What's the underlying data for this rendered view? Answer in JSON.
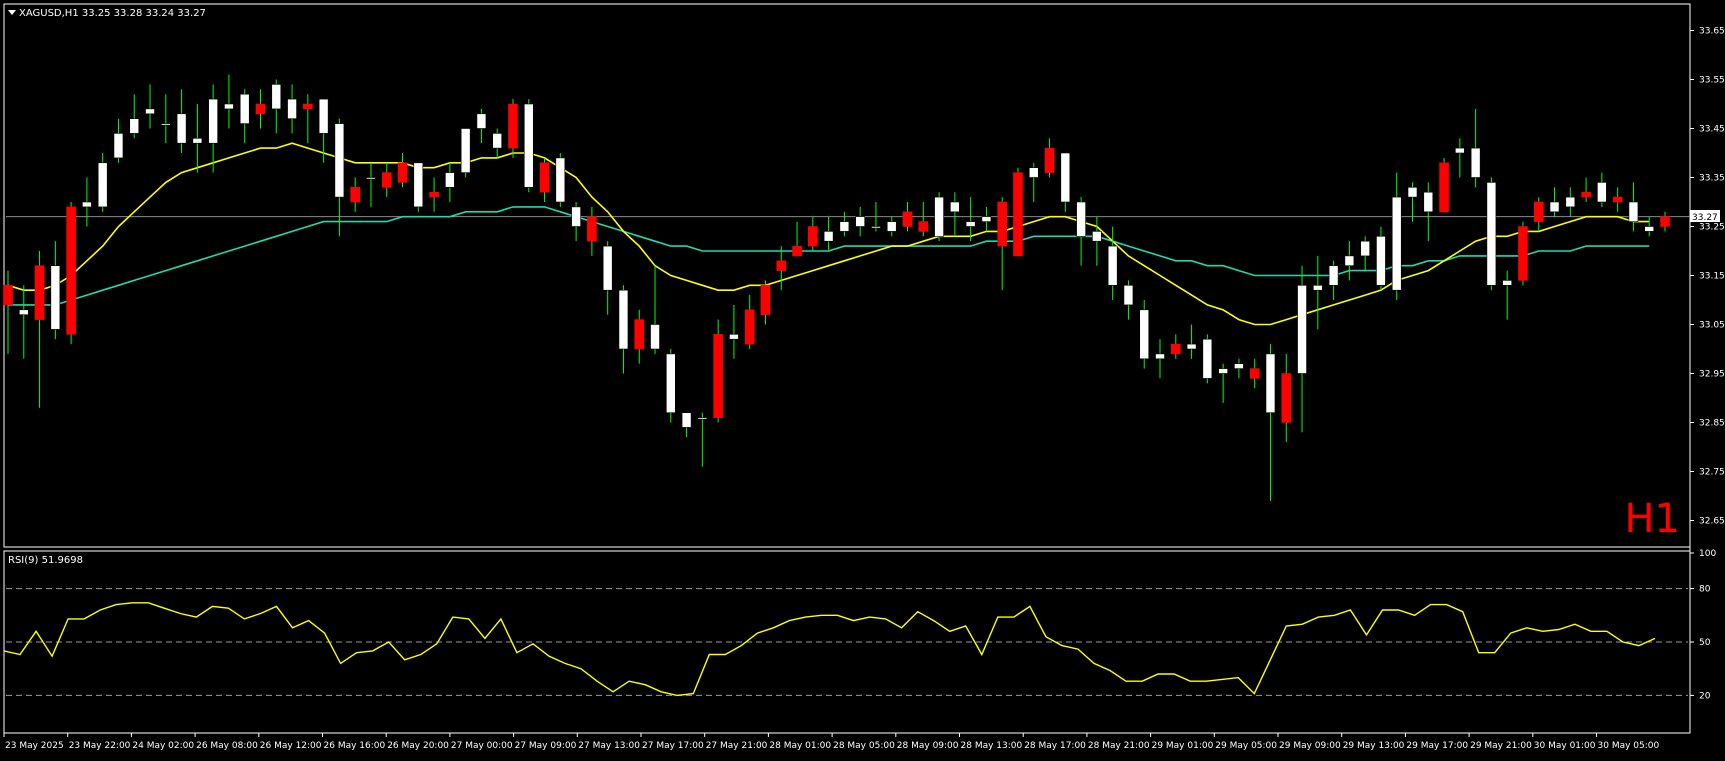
{
  "symbol_header": "XAGUSD,H1  33.25 33.28 33.24 33.27",
  "timeframe_label": "H1",
  "current_price_label": "33.27",
  "colors": {
    "background": "#000000",
    "grid_frame": "#ffffff",
    "bull_candle": "#ffffff",
    "bear_candle": "#ff0000",
    "wick": "#00ff00",
    "ma_fast": "#ffff00",
    "ma_slow": "#20d9b0",
    "rsi_line": "#ffff00",
    "timeframe_text": "#ff0000"
  },
  "chart_data": [
    {
      "type": "candlestick",
      "title": "XAGUSD,H1",
      "ylim": [
        32.6,
        33.7
      ],
      "y_ticks": [
        32.65,
        32.75,
        32.85,
        32.95,
        33.05,
        33.15,
        33.25,
        33.35,
        33.45,
        33.55,
        33.65
      ],
      "x_tick_labels": [
        "23 May 2025",
        "23 May 22:00",
        "24 May 02:00",
        "26 May 08:00",
        "26 May 12:00",
        "26 May 16:00",
        "26 May 20:00",
        "27 May 00:00",
        "27 May 09:00",
        "27 May 13:00",
        "27 May 17:00",
        "27 May 21:00",
        "28 May 01:00",
        "28 May 05:00",
        "28 May 09:00",
        "28 May 13:00",
        "28 May 17:00",
        "28 May 21:00",
        "29 May 01:00",
        "29 May 05:00",
        "29 May 09:00",
        "29 May 13:00",
        "29 May 17:00",
        "29 May 21:00",
        "30 May 01:00",
        "30 May 05:00"
      ],
      "candles": [
        {
          "o": 33.13,
          "h": 33.16,
          "l": 32.99,
          "c": 33.09
        },
        {
          "o": 33.07,
          "h": 33.13,
          "l": 32.98,
          "c": 33.08
        },
        {
          "o": 33.17,
          "h": 33.2,
          "l": 32.88,
          "c": 33.06
        },
        {
          "o": 33.04,
          "h": 33.22,
          "l": 33.02,
          "c": 33.17
        },
        {
          "o": 33.29,
          "h": 33.3,
          "l": 33.01,
          "c": 33.03
        },
        {
          "o": 33.29,
          "h": 33.35,
          "l": 33.25,
          "c": 33.3
        },
        {
          "o": 33.29,
          "h": 33.4,
          "l": 33.28,
          "c": 33.38
        },
        {
          "o": 33.39,
          "h": 33.47,
          "l": 33.38,
          "c": 33.44
        },
        {
          "o": 33.44,
          "h": 33.52,
          "l": 33.43,
          "c": 33.47
        },
        {
          "o": 33.48,
          "h": 33.54,
          "l": 33.45,
          "c": 33.49
        },
        {
          "o": 33.46,
          "h": 33.52,
          "l": 33.42,
          "c": 33.46
        },
        {
          "o": 33.42,
          "h": 33.53,
          "l": 33.4,
          "c": 33.48
        },
        {
          "o": 33.42,
          "h": 33.5,
          "l": 33.36,
          "c": 33.43
        },
        {
          "o": 33.42,
          "h": 33.54,
          "l": 33.36,
          "c": 33.51
        },
        {
          "o": 33.49,
          "h": 33.56,
          "l": 33.45,
          "c": 33.5
        },
        {
          "o": 33.46,
          "h": 33.53,
          "l": 33.42,
          "c": 33.52
        },
        {
          "o": 33.5,
          "h": 33.53,
          "l": 33.45,
          "c": 33.48
        },
        {
          "o": 33.49,
          "h": 33.55,
          "l": 33.44,
          "c": 33.54
        },
        {
          "o": 33.47,
          "h": 33.54,
          "l": 33.44,
          "c": 33.51
        },
        {
          "o": 33.5,
          "h": 33.52,
          "l": 33.42,
          "c": 33.49
        },
        {
          "o": 33.44,
          "h": 33.5,
          "l": 33.38,
          "c": 33.51
        },
        {
          "o": 33.31,
          "h": 33.47,
          "l": 33.23,
          "c": 33.46
        },
        {
          "o": 33.33,
          "h": 33.35,
          "l": 33.28,
          "c": 33.3
        },
        {
          "o": 33.35,
          "h": 33.38,
          "l": 33.29,
          "c": 33.35
        },
        {
          "o": 33.36,
          "h": 33.38,
          "l": 33.31,
          "c": 33.33
        },
        {
          "o": 33.38,
          "h": 33.4,
          "l": 33.33,
          "c": 33.34
        },
        {
          "o": 33.29,
          "h": 33.38,
          "l": 33.28,
          "c": 33.38
        },
        {
          "o": 33.32,
          "h": 33.35,
          "l": 33.28,
          "c": 33.31
        },
        {
          "o": 33.33,
          "h": 33.38,
          "l": 33.3,
          "c": 33.36
        },
        {
          "o": 33.36,
          "h": 33.45,
          "l": 33.35,
          "c": 33.45
        },
        {
          "o": 33.45,
          "h": 33.49,
          "l": 33.42,
          "c": 33.48
        },
        {
          "o": 33.41,
          "h": 33.45,
          "l": 33.39,
          "c": 33.44
        },
        {
          "o": 33.5,
          "h": 33.51,
          "l": 33.39,
          "c": 33.41
        },
        {
          "o": 33.33,
          "h": 33.51,
          "l": 33.32,
          "c": 33.5
        },
        {
          "o": 33.38,
          "h": 33.39,
          "l": 33.3,
          "c": 33.32
        },
        {
          "o": 33.3,
          "h": 33.4,
          "l": 33.29,
          "c": 33.39
        },
        {
          "o": 33.25,
          "h": 33.3,
          "l": 33.22,
          "c": 33.29
        },
        {
          "o": 33.27,
          "h": 33.29,
          "l": 33.19,
          "c": 33.22
        },
        {
          "o": 33.12,
          "h": 33.22,
          "l": 33.07,
          "c": 33.21
        },
        {
          "o": 33.0,
          "h": 33.13,
          "l": 32.95,
          "c": 33.12
        },
        {
          "o": 33.06,
          "h": 33.08,
          "l": 32.97,
          "c": 33.0
        },
        {
          "o": 33.0,
          "h": 33.17,
          "l": 32.99,
          "c": 33.05
        },
        {
          "o": 32.87,
          "h": 33.0,
          "l": 32.85,
          "c": 32.99
        },
        {
          "o": 32.84,
          "h": 32.87,
          "l": 32.82,
          "c": 32.87
        },
        {
          "o": 32.86,
          "h": 32.87,
          "l": 32.76,
          "c": 32.86
        },
        {
          "o": 33.03,
          "h": 33.06,
          "l": 32.85,
          "c": 32.86
        },
        {
          "o": 33.02,
          "h": 33.09,
          "l": 32.98,
          "c": 33.03
        },
        {
          "o": 33.08,
          "h": 33.11,
          "l": 33.0,
          "c": 33.01
        },
        {
          "o": 33.13,
          "h": 33.14,
          "l": 33.05,
          "c": 33.07
        },
        {
          "o": 33.18,
          "h": 33.21,
          "l": 33.12,
          "c": 33.16
        },
        {
          "o": 33.21,
          "h": 33.26,
          "l": 33.19,
          "c": 33.19
        },
        {
          "o": 33.25,
          "h": 33.27,
          "l": 33.2,
          "c": 33.21
        },
        {
          "o": 33.22,
          "h": 33.27,
          "l": 33.2,
          "c": 33.24
        },
        {
          "o": 33.24,
          "h": 33.28,
          "l": 33.23,
          "c": 33.26
        },
        {
          "o": 33.25,
          "h": 33.29,
          "l": 33.23,
          "c": 33.27
        },
        {
          "o": 33.25,
          "h": 33.3,
          "l": 33.24,
          "c": 33.25
        },
        {
          "o": 33.24,
          "h": 33.27,
          "l": 33.23,
          "c": 33.26
        },
        {
          "o": 33.28,
          "h": 33.3,
          "l": 33.24,
          "c": 33.25
        },
        {
          "o": 33.26,
          "h": 33.3,
          "l": 33.23,
          "c": 33.24
        },
        {
          "o": 33.23,
          "h": 33.32,
          "l": 33.22,
          "c": 33.31
        },
        {
          "o": 33.28,
          "h": 33.32,
          "l": 33.23,
          "c": 33.3
        },
        {
          "o": 33.25,
          "h": 33.31,
          "l": 33.22,
          "c": 33.26
        },
        {
          "o": 33.26,
          "h": 33.29,
          "l": 33.24,
          "c": 33.27
        },
        {
          "o": 33.3,
          "h": 33.31,
          "l": 33.12,
          "c": 33.21
        },
        {
          "o": 33.36,
          "h": 33.37,
          "l": 33.19,
          "c": 33.19
        },
        {
          "o": 33.35,
          "h": 33.38,
          "l": 33.3,
          "c": 33.37
        },
        {
          "o": 33.41,
          "h": 33.43,
          "l": 33.35,
          "c": 33.36
        },
        {
          "o": 33.3,
          "h": 33.4,
          "l": 33.28,
          "c": 33.4
        },
        {
          "o": 33.23,
          "h": 33.31,
          "l": 33.17,
          "c": 33.3
        },
        {
          "o": 33.22,
          "h": 33.27,
          "l": 33.17,
          "c": 33.24
        },
        {
          "o": 33.13,
          "h": 33.25,
          "l": 33.1,
          "c": 33.21
        },
        {
          "o": 33.09,
          "h": 33.14,
          "l": 33.06,
          "c": 33.13
        },
        {
          "o": 32.98,
          "h": 33.1,
          "l": 32.96,
          "c": 33.08
        },
        {
          "o": 32.98,
          "h": 33.02,
          "l": 32.94,
          "c": 32.99
        },
        {
          "o": 33.01,
          "h": 33.03,
          "l": 32.98,
          "c": 32.99
        },
        {
          "o": 33.0,
          "h": 33.05,
          "l": 32.98,
          "c": 33.01
        },
        {
          "o": 32.94,
          "h": 33.03,
          "l": 32.93,
          "c": 33.02
        },
        {
          "o": 32.95,
          "h": 32.97,
          "l": 32.89,
          "c": 32.96
        },
        {
          "o": 32.96,
          "h": 32.98,
          "l": 32.94,
          "c": 32.97
        },
        {
          "o": 32.96,
          "h": 32.98,
          "l": 32.92,
          "c": 32.94
        },
        {
          "o": 32.87,
          "h": 33.01,
          "l": 32.69,
          "c": 32.99
        },
        {
          "o": 32.95,
          "h": 32.99,
          "l": 32.81,
          "c": 32.85
        },
        {
          "o": 32.95,
          "h": 33.17,
          "l": 32.83,
          "c": 33.13
        },
        {
          "o": 33.12,
          "h": 33.19,
          "l": 33.04,
          "c": 33.13
        },
        {
          "o": 33.13,
          "h": 33.18,
          "l": 33.1,
          "c": 33.17
        },
        {
          "o": 33.17,
          "h": 33.22,
          "l": 33.14,
          "c": 33.19
        },
        {
          "o": 33.19,
          "h": 33.23,
          "l": 33.16,
          "c": 33.22
        },
        {
          "o": 33.13,
          "h": 33.25,
          "l": 33.12,
          "c": 33.23
        },
        {
          "o": 33.12,
          "h": 33.36,
          "l": 33.1,
          "c": 33.31
        },
        {
          "o": 33.31,
          "h": 33.34,
          "l": 33.26,
          "c": 33.33
        },
        {
          "o": 33.28,
          "h": 33.34,
          "l": 33.22,
          "c": 33.32
        },
        {
          "o": 33.38,
          "h": 33.39,
          "l": 33.28,
          "c": 33.28
        },
        {
          "o": 33.4,
          "h": 33.43,
          "l": 33.35,
          "c": 33.41
        },
        {
          "o": 33.35,
          "h": 33.49,
          "l": 33.33,
          "c": 33.41
        },
        {
          "o": 33.13,
          "h": 33.35,
          "l": 33.12,
          "c": 33.34
        },
        {
          "o": 33.13,
          "h": 33.16,
          "l": 33.06,
          "c": 33.14
        },
        {
          "o": 33.25,
          "h": 33.26,
          "l": 33.13,
          "c": 33.14
        },
        {
          "o": 33.3,
          "h": 33.31,
          "l": 33.24,
          "c": 33.26
        },
        {
          "o": 33.28,
          "h": 33.33,
          "l": 33.27,
          "c": 33.3
        },
        {
          "o": 33.29,
          "h": 33.33,
          "l": 33.27,
          "c": 33.31
        },
        {
          "o": 33.32,
          "h": 33.35,
          "l": 33.3,
          "c": 33.31
        },
        {
          "o": 33.3,
          "h": 33.36,
          "l": 33.29,
          "c": 33.34
        },
        {
          "o": 33.31,
          "h": 33.33,
          "l": 33.28,
          "c": 33.3
        },
        {
          "o": 33.26,
          "h": 33.34,
          "l": 33.24,
          "c": 33.3
        },
        {
          "o": 33.24,
          "h": 33.27,
          "l": 33.23,
          "c": 33.25
        },
        {
          "o": 33.27,
          "h": 33.28,
          "l": 33.24,
          "c": 33.25
        }
      ],
      "ma_fast": [
        33.13,
        33.12,
        33.12,
        33.13,
        33.15,
        33.18,
        33.21,
        33.25,
        33.28,
        33.31,
        33.34,
        33.36,
        33.37,
        33.38,
        33.39,
        33.4,
        33.41,
        33.41,
        33.42,
        33.41,
        33.4,
        33.39,
        33.38,
        33.38,
        33.38,
        33.38,
        33.37,
        33.37,
        33.38,
        33.38,
        33.39,
        33.39,
        33.4,
        33.4,
        33.39,
        33.37,
        33.35,
        33.31,
        33.28,
        33.24,
        33.21,
        33.17,
        33.15,
        33.14,
        33.13,
        33.12,
        33.12,
        33.13,
        33.13,
        33.14,
        33.15,
        33.16,
        33.17,
        33.18,
        33.19,
        33.2,
        33.21,
        33.21,
        33.22,
        33.23,
        33.23,
        33.23,
        33.24,
        33.24,
        33.25,
        33.26,
        33.27,
        33.27,
        33.26,
        33.25,
        33.22,
        33.19,
        33.17,
        33.15,
        33.13,
        33.11,
        33.09,
        33.08,
        33.06,
        33.05,
        33.05,
        33.06,
        33.07,
        33.08,
        33.09,
        33.1,
        33.11,
        33.12,
        33.14,
        33.15,
        33.16,
        33.18,
        33.2,
        33.22,
        33.23,
        33.23,
        33.24,
        33.24,
        33.25,
        33.26,
        33.27,
        33.27,
        33.27,
        33.26,
        33.26
      ],
      "ma_slow": [
        33.09,
        33.09,
        33.09,
        33.09,
        33.1,
        33.11,
        33.12,
        33.13,
        33.14,
        33.15,
        33.16,
        33.17,
        33.18,
        33.19,
        33.2,
        33.21,
        33.22,
        33.23,
        33.24,
        33.25,
        33.26,
        33.26,
        33.26,
        33.26,
        33.26,
        33.27,
        33.27,
        33.27,
        33.27,
        33.28,
        33.28,
        33.28,
        33.29,
        33.29,
        33.29,
        33.28,
        33.27,
        33.26,
        33.25,
        33.24,
        33.23,
        33.22,
        33.21,
        33.21,
        33.2,
        33.2,
        33.2,
        33.2,
        33.2,
        33.2,
        33.2,
        33.2,
        33.2,
        33.21,
        33.21,
        33.21,
        33.21,
        33.21,
        33.21,
        33.21,
        33.21,
        33.21,
        33.22,
        33.22,
        33.22,
        33.23,
        33.23,
        33.23,
        33.23,
        33.23,
        33.22,
        33.21,
        33.2,
        33.19,
        33.18,
        33.18,
        33.17,
        33.17,
        33.16,
        33.15,
        33.15,
        33.15,
        33.15,
        33.15,
        33.15,
        33.16,
        33.16,
        33.16,
        33.17,
        33.17,
        33.18,
        33.18,
        33.19,
        33.19,
        33.19,
        33.19,
        33.19,
        33.2,
        33.2,
        33.2,
        33.21,
        33.21,
        33.21,
        33.21,
        33.21
      ],
      "current_price": 33.27
    },
    {
      "type": "line",
      "title": "RSI(9) 51.9698",
      "ylim": [
        0,
        100
      ],
      "y_ticks": [
        20,
        50,
        80,
        100
      ],
      "levels": [
        20,
        50,
        80
      ],
      "series": [
        {
          "name": "RSI(9)",
          "values": [
            45,
            43,
            56,
            42,
            63,
            63,
            68,
            71,
            72,
            72,
            69,
            66,
            64,
            70,
            69,
            63,
            66,
            70,
            58,
            62,
            55,
            38,
            44,
            45,
            50,
            40,
            43,
            49,
            64,
            63,
            52,
            63,
            44,
            49,
            42,
            38,
            35,
            28,
            22,
            28,
            26,
            22,
            20,
            21,
            43,
            43,
            48,
            55,
            58,
            62,
            64,
            65,
            65,
            62,
            64,
            63,
            58,
            67,
            62,
            56,
            59,
            43,
            64,
            64,
            70,
            53,
            48,
            46,
            38,
            34,
            28,
            28,
            32,
            32,
            28,
            28,
            29,
            30,
            21,
            40,
            59,
            60,
            64,
            65,
            68,
            54,
            68,
            68,
            65,
            71,
            71,
            67,
            44,
            44,
            55,
            58,
            56,
            57,
            60,
            56,
            56,
            50,
            48,
            52
          ]
        }
      ]
    }
  ]
}
